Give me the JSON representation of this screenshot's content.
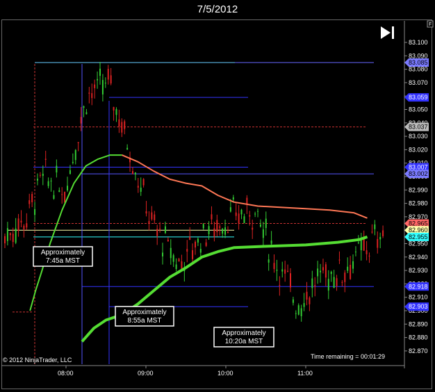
{
  "chart_data": {
    "type": "line",
    "title": "7/5/2012",
    "y_ticks": [
      "83.100",
      "83.090",
      "83.080",
      "83.070",
      "83.060",
      "83.050",
      "83.040",
      "83.030",
      "83.020",
      "83.010",
      "83.000",
      "82.990",
      "82.980",
      "82.970",
      "82.960",
      "82.950",
      "82.940",
      "82.930",
      "82.920",
      "82.910",
      "82.900",
      "82.890",
      "82.880",
      "82.870"
    ],
    "x_ticks": [
      "08:00",
      "09:00",
      "10:00",
      "11:00"
    ],
    "ylim": [
      82.87,
      83.1
    ],
    "price_tags": [
      {
        "label": "83.085",
        "value": 83.085,
        "color": "#7a7aff",
        "text": "#000"
      },
      {
        "label": "83.059",
        "value": 83.059,
        "color": "#3333ff",
        "text": "#fff"
      },
      {
        "label": "83.037",
        "value": 83.037,
        "color": "#bbbbbb",
        "text": "#000"
      },
      {
        "label": "83.007",
        "value": 83.007,
        "color": "#3333ff",
        "text": "#fff"
      },
      {
        "label": "83.002",
        "value": 83.002,
        "color": "#7a7aff",
        "text": "#000"
      },
      {
        "label": "82.965",
        "value": 82.965,
        "color": "#ff6666",
        "text": "#000"
      },
      {
        "label": "82.960",
        "value": 82.96,
        "color": "#ffffaa",
        "text": "#000"
      },
      {
        "label": "82.955",
        "value": 82.955,
        "color": "#33ffff",
        "text": "#000"
      },
      {
        "label": "82.918",
        "value": 82.918,
        "color": "#3333ff",
        "text": "#fff"
      },
      {
        "label": "82.903",
        "value": 82.903,
        "color": "#3333ff",
        "text": "#fff"
      }
    ],
    "annotations": [
      {
        "line1": "Approximately",
        "line2": "7:45a MST"
      },
      {
        "line1": "Approximately",
        "line2": "8:55a MST"
      },
      {
        "line1": "Approximately",
        "line2": "10:20a MST"
      }
    ],
    "series": [
      {
        "color": "#55dd33",
        "values": [
          [
            7.55,
            82.9
          ],
          [
            7.62,
            82.915
          ],
          [
            7.7,
            82.93
          ],
          [
            7.8,
            82.95
          ],
          [
            7.95,
            82.975
          ],
          [
            8.1,
            82.995
          ],
          [
            8.25,
            83.008
          ],
          [
            8.4,
            83.013
          ],
          [
            8.55,
            83.016
          ],
          [
            8.7,
            83.016
          ]
        ]
      },
      {
        "color": "#ff7755",
        "values": [
          [
            8.7,
            83.016
          ],
          [
            8.9,
            83.011
          ],
          [
            9.1,
            83.004
          ],
          [
            9.3,
            82.998
          ],
          [
            9.5,
            82.995
          ],
          [
            9.7,
            82.993
          ],
          [
            9.9,
            82.986
          ],
          [
            10.1,
            82.981
          ],
          [
            10.4,
            82.978
          ],
          [
            10.7,
            82.977
          ],
          [
            11.0,
            82.976
          ],
          [
            11.3,
            82.975
          ],
          [
            11.6,
            82.973
          ],
          [
            11.77,
            82.969
          ]
        ]
      },
      {
        "color": "#55dd33",
        "values": [
          [
            8.2,
            82.877
          ],
          [
            8.35,
            82.887
          ],
          [
            8.5,
            82.893
          ],
          [
            8.7,
            82.897
          ],
          [
            8.9,
            82.905
          ],
          [
            9.1,
            82.915
          ],
          [
            9.3,
            82.925
          ],
          [
            9.5,
            82.932
          ],
          [
            9.7,
            82.94
          ],
          [
            9.9,
            82.944
          ],
          [
            10.1,
            82.947
          ],
          [
            10.5,
            82.948
          ],
          [
            11.0,
            82.949
          ],
          [
            11.4,
            82.951
          ],
          [
            11.67,
            82.953
          ],
          [
            11.77,
            82.955
          ]
        ]
      }
    ],
    "footer_left": "© 2012 NinjaTrader, LLC",
    "footer_right": "Time remaining = 00:01:29",
    "corner_label": "F"
  }
}
